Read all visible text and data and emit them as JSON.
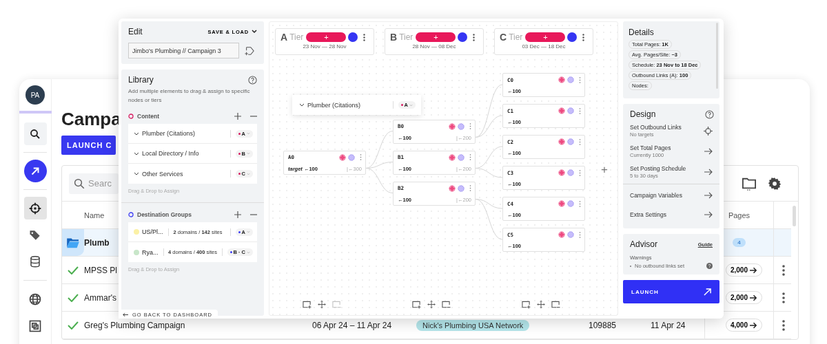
{
  "app": {
    "avatar": "PA",
    "nav": [
      {
        "kind": "search",
        "selected": false
      },
      {
        "kind": "launch",
        "selected": false
      },
      {
        "kind": "target",
        "selected": true
      },
      {
        "kind": "tags",
        "selected": false
      },
      {
        "kind": "database",
        "selected": false
      },
      {
        "kind": "globe",
        "selected": false
      },
      {
        "kind": "frame",
        "selected": false
      }
    ],
    "page_title": "Campa",
    "launch_button": "LAUNCH C",
    "search": {
      "placeholder": "Searc"
    },
    "table": {
      "columns": [
        "Name",
        "Pages"
      ],
      "rows": [
        {
          "kind": "group",
          "name": "Plumb",
          "count": "4"
        },
        {
          "kind": "campaign",
          "completed": true,
          "name": "MPSS Pl",
          "pages": "2,000"
        },
        {
          "kind": "campaign",
          "completed": true,
          "name": "Ammar's",
          "pages": "2,000"
        },
        {
          "kind": "campaign",
          "completed": true,
          "name": "Greg's Plumbing Campaign",
          "column_3": "06 Apr 24 – 11 Apr 24",
          "column_4": "Nick's Plumbing USA Network",
          "column_5": "109885",
          "column_6": "11 Apr 24",
          "pages": "4,000"
        }
      ]
    }
  },
  "editor": {
    "edit": {
      "title": "Edit",
      "save_load": "SAVE & LOAD",
      "campaign_name": "Jimbo's Plumbing // Campaign 3"
    },
    "library": {
      "title": "Library",
      "description": "Add multiple elements to drag & assign to specific nodes or tiers",
      "content": {
        "title": "Content",
        "items": [
          {
            "label": "Plumber (Citations)",
            "tier": "A"
          },
          {
            "label": "Local Directory / Info",
            "tier": "B"
          },
          {
            "label": "Other Services",
            "tier": "C"
          }
        ],
        "hint": "Drag & Drop to Assign"
      },
      "destinations": {
        "title": "Destination Groups",
        "items": [
          {
            "name": "US/Pl...",
            "stats": "**2** domains / **142** sites",
            "tiers": "A",
            "color": "#fbf1a6"
          },
          {
            "name": "Rya...",
            "stats": "**4** domains / **400** sites",
            "tiers": "B · C",
            "color": "#c8e6c9"
          }
        ],
        "hint": "Drag & Drop to Assign"
      }
    },
    "back_button": "GO BACK TO DASHBOARD",
    "tiers": [
      {
        "letter": "A",
        "label": "Tier",
        "add": "+",
        "dates": "23 Nov — 28 Nov"
      },
      {
        "letter": "B",
        "label": "Tier",
        "add": "+",
        "dates": "28 Nov — 08 Dec"
      },
      {
        "letter": "C",
        "label": "Tier",
        "add": "+",
        "dates": "03 Dec — 18 Dec"
      }
    ],
    "dragged_item": {
      "label": "Plumber (Citations)",
      "tier": "A"
    },
    "nodes": [
      {
        "label": "A0",
        "links": "*target* ←100",
        "incoming": "|←300",
        "children": [
          {
            "label": "B0",
            "links": "←100",
            "incoming": "|←200",
            "children": [
              {
                "label": "C0",
                "links": "←100"
              },
              {
                "label": "C1",
                "links": "←100"
              }
            ]
          },
          {
            "label": "B1",
            "links": "←100",
            "incoming": "|←200",
            "children": [
              {
                "label": "C2",
                "links": "←100"
              },
              {
                "label": "C3",
                "links": "←100"
              }
            ]
          },
          {
            "label": "B2",
            "links": "←100",
            "incoming": "|←200",
            "children": [
              {
                "label": "C4",
                "links": "←100"
              },
              {
                "label": "C5",
                "links": "←100"
              }
            ]
          }
        ]
      }
    ],
    "add_tier": "+",
    "toolbars": [
      {
        "remove_disabled": true
      },
      {
        "remove_disabled": false
      },
      {
        "remove_disabled": false
      }
    ],
    "details": {
      "title": "Details",
      "stats": [
        "Total Pages: **1K**",
        "Avg. Pages/Site: **~3**",
        "Schedule: **23 Nov to 18 Dec**",
        "Outbound Links (A): **100**",
        "Nodes:"
      ]
    },
    "design": {
      "title": "Design",
      "groups": [
        [
          {
            "title": "Set Outbound Links",
            "subtitle": "No targets",
            "kind": "target"
          },
          {
            "title": "Set Total Pages",
            "subtitle": "Currently 1000",
            "kind": "arrow"
          },
          {
            "title": "Set Posting Schedule",
            "subtitle": "5 to 30 days",
            "kind": "arrow"
          }
        ],
        [
          {
            "title": "Campaign Variables",
            "kind": "arrow"
          },
          {
            "title": "Extra Settings",
            "kind": "arrow"
          }
        ]
      ]
    },
    "advisor": {
      "title": "Advisor",
      "guide": "Guide",
      "warnings_title": "Warnings",
      "warnings": [
        "No outbound links set"
      ]
    },
    "launch": "LAUNCH"
  }
}
